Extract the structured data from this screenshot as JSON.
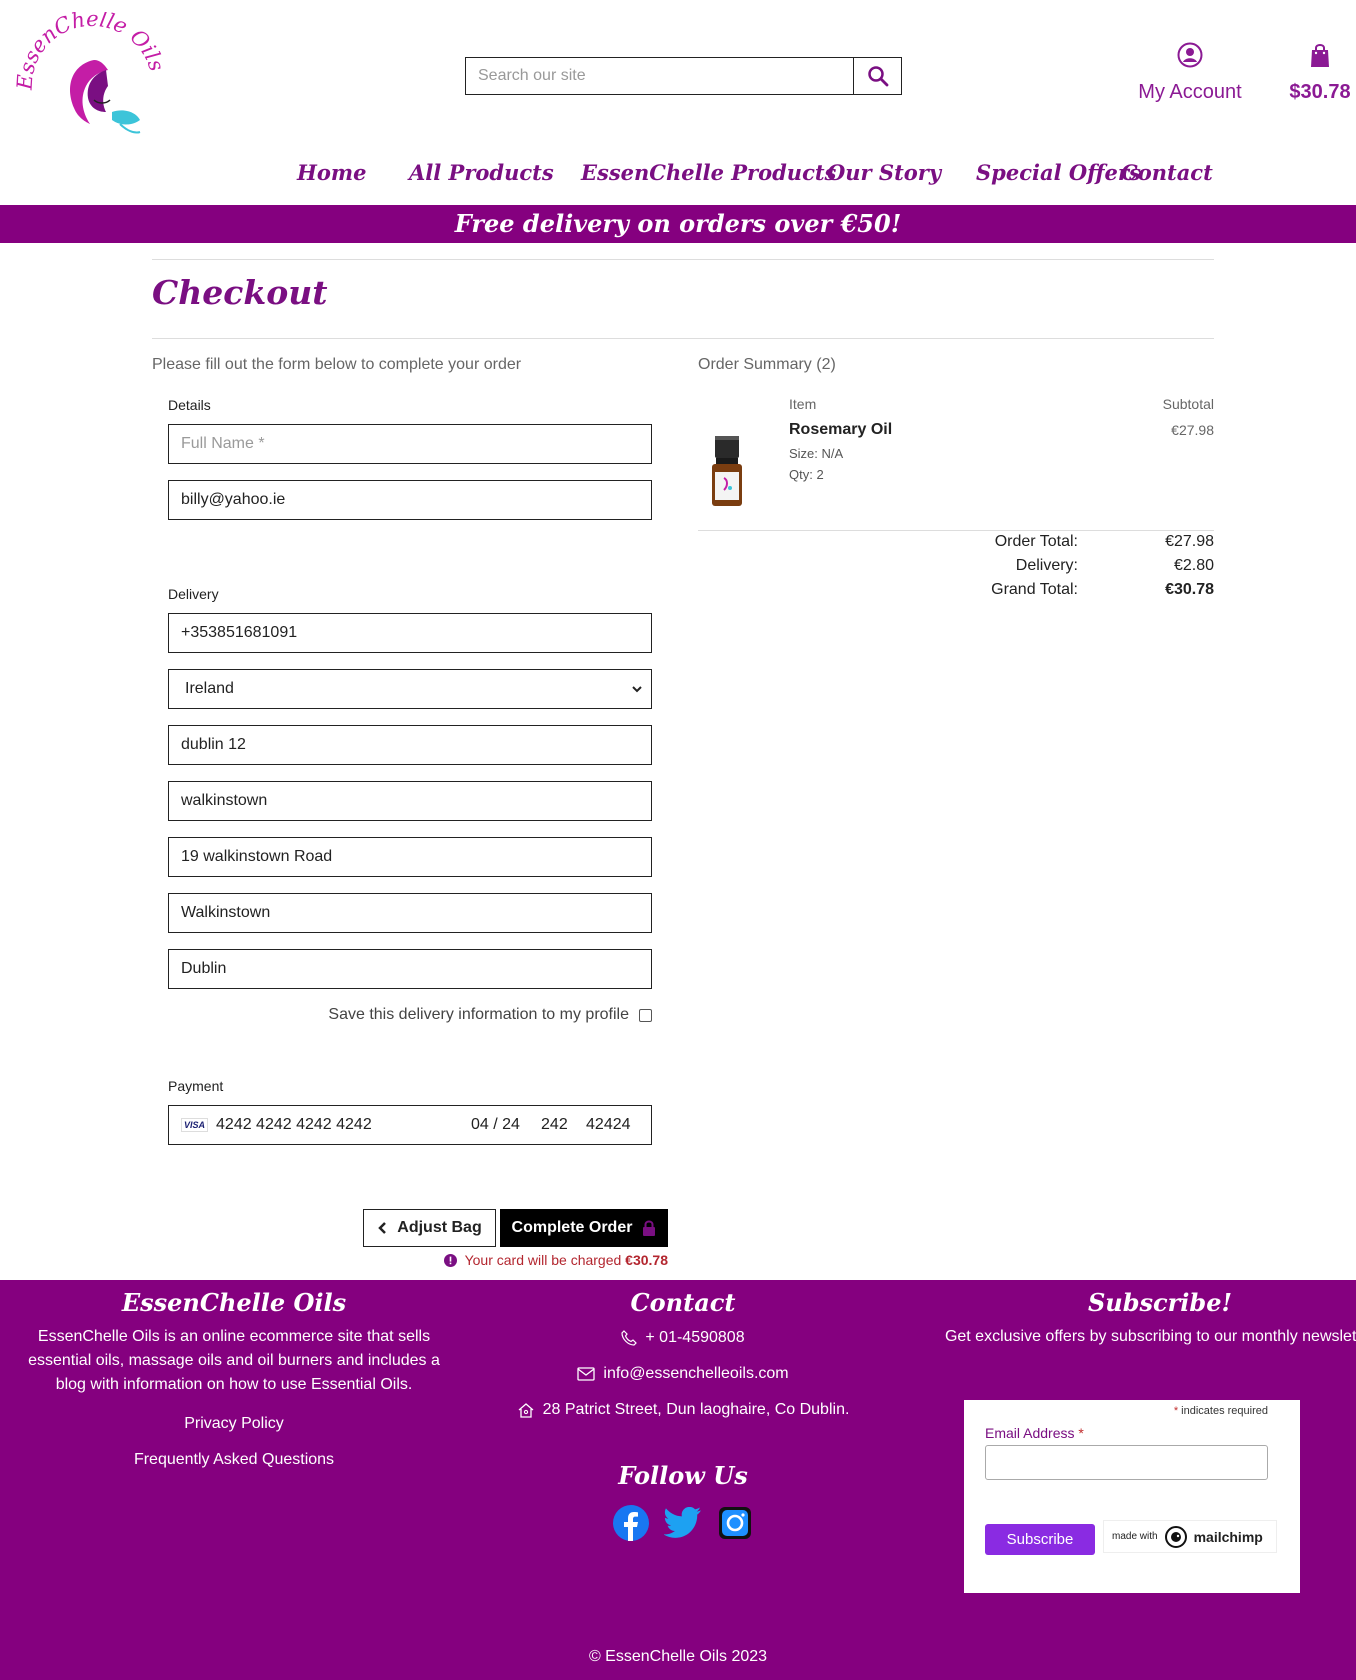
{
  "brand": {
    "logo_text": "EssenChelle Oils",
    "primary_color": "#85007f",
    "accent_color": "#c41da6",
    "teal_color": "#3cc4d9"
  },
  "header": {
    "search_placeholder": "Search our site",
    "account_label": "My Account",
    "bag_total": "$30.78"
  },
  "nav": [
    {
      "label": "Home"
    },
    {
      "label": "All Products"
    },
    {
      "label": "EssenChelle Products"
    },
    {
      "label": "Our Story"
    },
    {
      "label": "Special Offers"
    },
    {
      "label": "Contact"
    }
  ],
  "banner": "Free delivery on orders over €50!",
  "checkout": {
    "title": "Checkout",
    "intro": "Please fill out the form below to complete your order",
    "details_label": "Details",
    "full_name_placeholder": "Full Name *",
    "email": "billy@yahoo.ie",
    "delivery_label": "Delivery",
    "phone": "+353851681091",
    "country": "Ireland",
    "postcode": "dublin 12",
    "town": "walkinstown",
    "street1": "19 walkinstown Road",
    "street2": "Walkinstown",
    "county": "Dublin",
    "save_info_label": "Save this delivery information to my profile",
    "payment_label": "Payment",
    "card": {
      "brand": "VISA",
      "number": "4242 4242 4242 4242",
      "expiry": "04 / 24",
      "cvc": "242",
      "postal": "42424"
    },
    "adjust_label": "Adjust Bag",
    "complete_label": "Complete Order",
    "charge_text": "Your card will be charged",
    "charge_amount": "€30.78"
  },
  "summary": {
    "title": "Order Summary (2)",
    "col_item": "Item",
    "col_subtotal": "Subtotal",
    "items": [
      {
        "name": "Rosemary Oil",
        "size": "Size: N/A",
        "qty": "Qty: 2",
        "subtotal": "€27.98"
      }
    ],
    "order_total_label": "Order Total:",
    "order_total": "€27.98",
    "delivery_label": "Delivery:",
    "delivery": "€2.80",
    "grand_total_label": "Grand Total:",
    "grand_total": "€30.78"
  },
  "footer": {
    "about_heading": "EssenChelle Oils",
    "about_text": "EssenChelle Oils is an online ecommerce site that sells essential oils, massage oils and oil burners and includes a blog with information on how to use Essential Oils.",
    "privacy_link": "Privacy Policy",
    "faq_link": "Frequently Asked Questions",
    "contact_heading": "Contact",
    "phone": "+ 01-4590808",
    "email": "info@essenchelleoils.com",
    "address": "28 Patrict Street, Dun laoghaire, Co Dublin.",
    "follow_heading": "Follow Us",
    "social_icons": [
      "facebook-icon",
      "twitter-icon",
      "instagram-icon"
    ],
    "subscribe_heading": "Subscribe!",
    "subscribe_text": "Get exclusive offers by subscribing to our monthly newsletter",
    "mc_required": "indicates required",
    "mc_email_label": "Email Address",
    "mc_button": "Subscribe",
    "mc_made_with": "made with",
    "mc_brand": "mailchimp",
    "copyright": "© EssenChelle Oils 2023"
  }
}
